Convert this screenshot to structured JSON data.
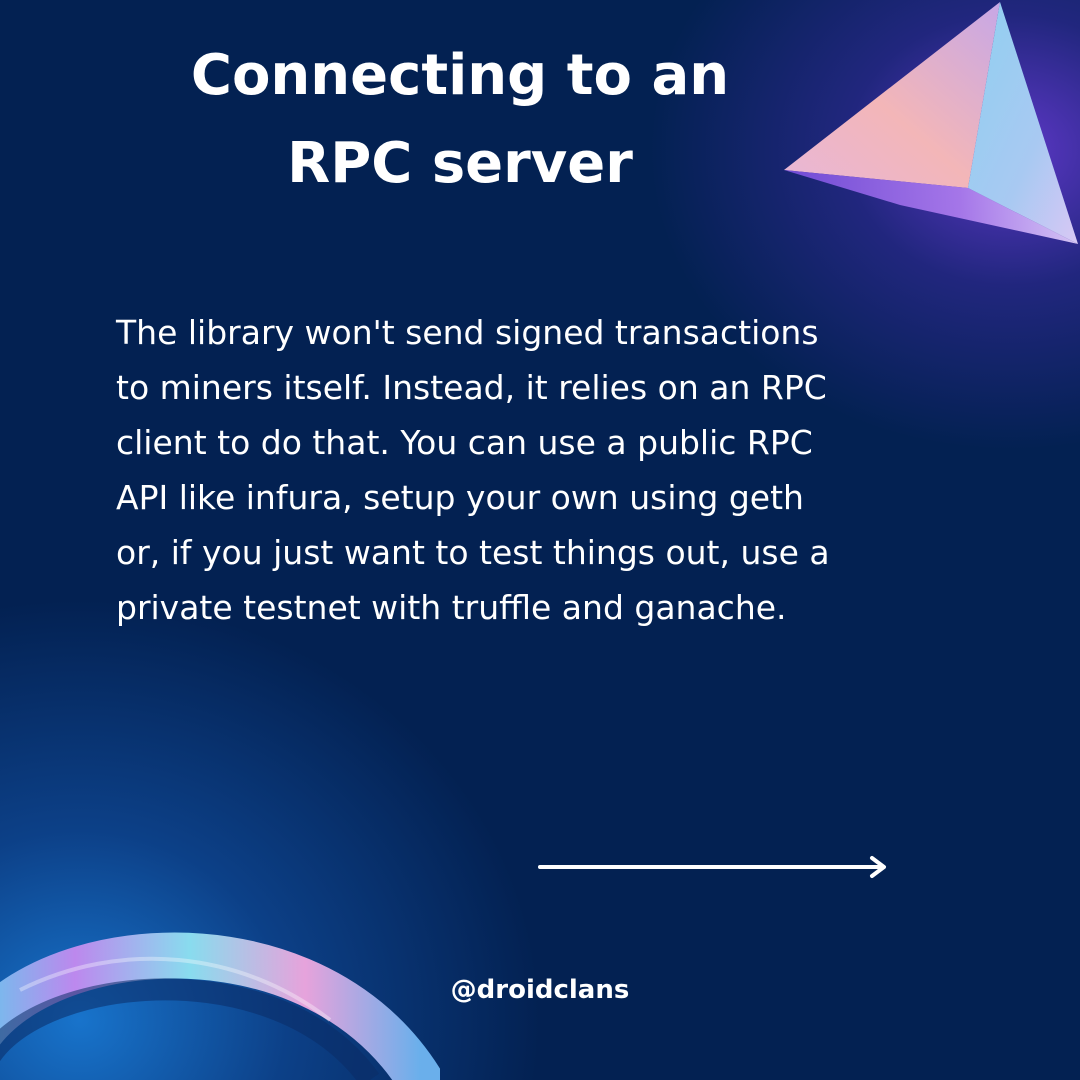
{
  "slide": {
    "title": "Connecting to an\nRPC server",
    "body": "The library won't send signed transactions\nto miners itself. Instead, it relies on an RPC\nclient to do that. You can use a public RPC\nAPI like infura, setup your own using geth\nor, if you just want to test things out, use a\nprivate testnet with truffle and ganache.",
    "handle": "@droidclans"
  },
  "icons": {
    "top_right": "pyramid-graphic",
    "bottom_left": "holographic-ring-graphic",
    "next": "arrow-right-icon"
  },
  "colors": {
    "background": "#032152",
    "text": "#ffffff",
    "glow_purple": "#6e3cdc",
    "glow_blue": "#1978d2"
  }
}
